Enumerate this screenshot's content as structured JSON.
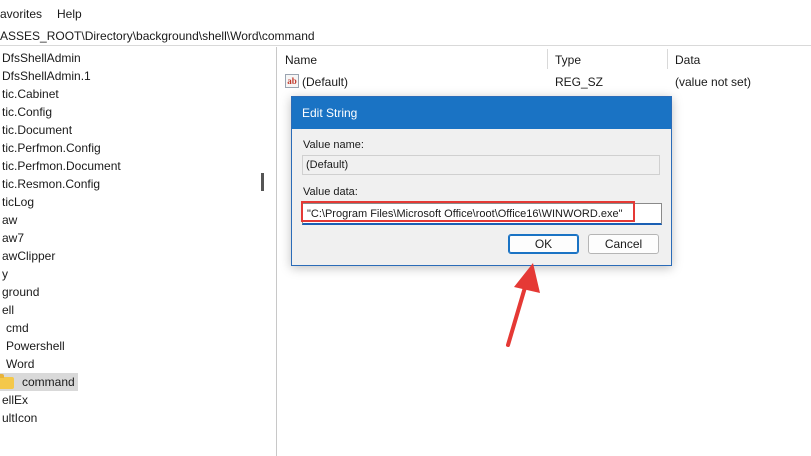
{
  "menubar": {
    "items": [
      "avorites",
      "Help"
    ]
  },
  "address": {
    "path": "ASSES_ROOT\\Directory\\background\\shell\\Word\\command"
  },
  "tree": {
    "items": [
      "DfsShellAdmin",
      "DfsShellAdmin.1",
      "tic.Cabinet",
      "tic.Config",
      "tic.Document",
      "tic.Perfmon.Config",
      "tic.Perfmon.Document",
      "tic.Resmon.Config",
      "ticLog",
      "aw",
      "aw7",
      "awClipper",
      "y",
      "ground",
      "ell",
      "cmd",
      "Powershell",
      "Word",
      "command",
      "ellEx",
      "ultIcon"
    ]
  },
  "list": {
    "headers": {
      "name": "Name",
      "type": "Type",
      "data": "Data"
    },
    "rows": [
      {
        "name": "(Default)",
        "type": "REG_SZ",
        "data": "(value not set)",
        "icon": "string-value-icon"
      }
    ]
  },
  "dialog": {
    "title": "Edit String",
    "value_name_label": "Value name:",
    "value_name": "(Default)",
    "value_data_label": "Value data:",
    "value_data": "\"C:\\Program Files\\Microsoft Office\\root\\Office16\\WINWORD.exe\"",
    "ok_label": "OK",
    "cancel_label": "Cancel"
  },
  "colors": {
    "accent": "#1a73c4",
    "annotation": "#e53935",
    "selection": "#d9d9d9"
  }
}
